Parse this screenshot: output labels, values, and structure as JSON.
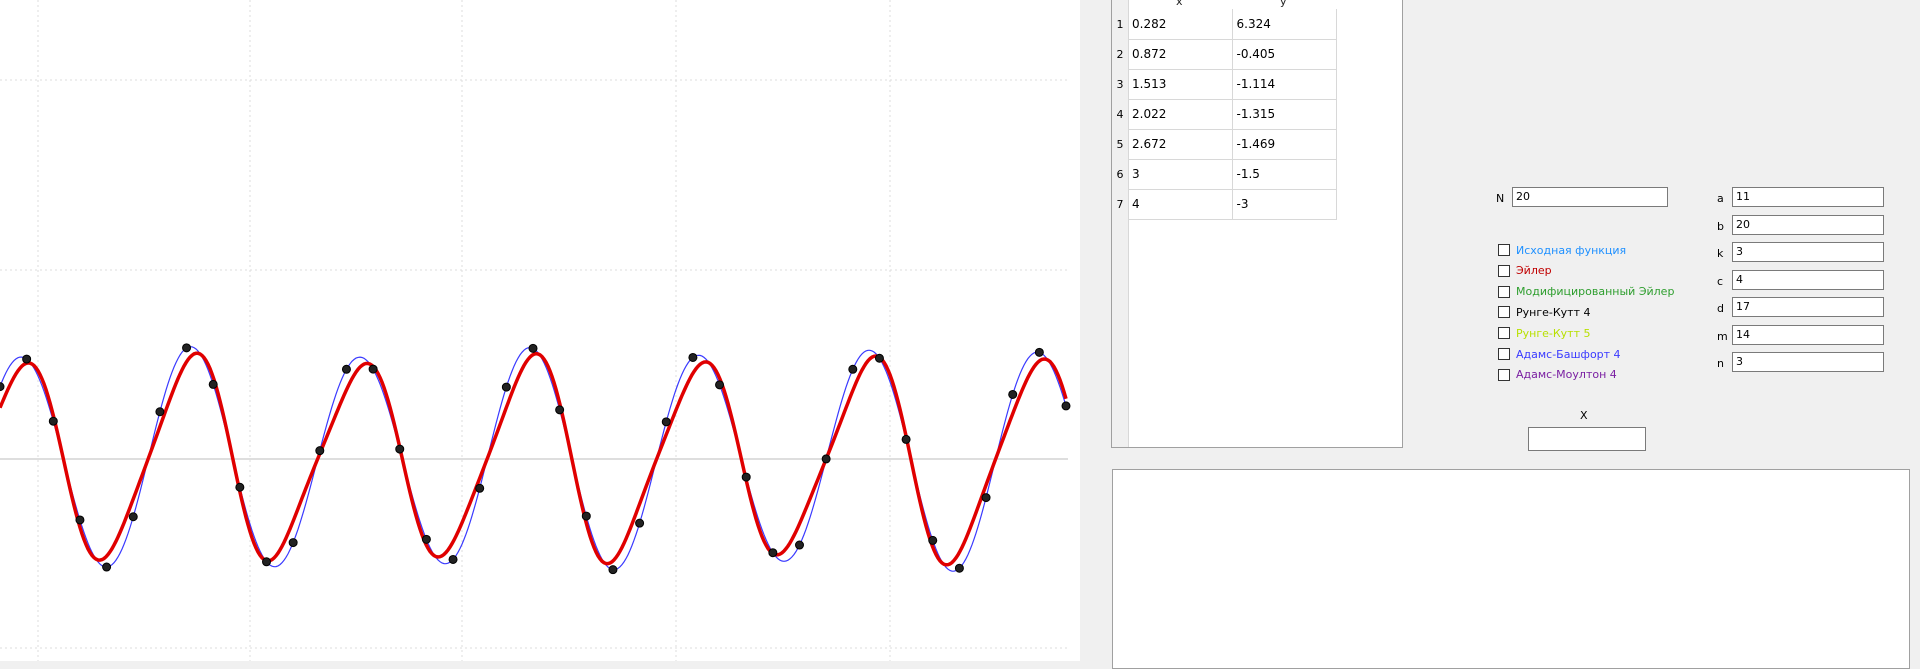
{
  "table": {
    "col_x": "x",
    "col_y": "y",
    "rows": [
      {
        "n": "1",
        "x": "0.282",
        "y": "6.324"
      },
      {
        "n": "2",
        "x": "0.872",
        "y": "-0.405"
      },
      {
        "n": "3",
        "x": "1.513",
        "y": "-1.114"
      },
      {
        "n": "4",
        "x": "2.022",
        "y": "-1.315"
      },
      {
        "n": "5",
        "x": "2.672",
        "y": "-1.469"
      },
      {
        "n": "6",
        "x": "3",
        "y": "-1.5"
      },
      {
        "n": "7",
        "x": "4",
        "y": "-3"
      }
    ]
  },
  "n_field": {
    "label": "N",
    "value": "20"
  },
  "params": [
    {
      "label": "a",
      "value": "11"
    },
    {
      "label": "b",
      "value": "20"
    },
    {
      "label": "k",
      "value": "3"
    },
    {
      "label": "c",
      "value": "4"
    },
    {
      "label": "d",
      "value": "17"
    },
    {
      "label": "m",
      "value": "14"
    },
    {
      "label": "n",
      "value": "3"
    }
  ],
  "methods": [
    {
      "label": "Исходная функция",
      "color": "#1e90ff",
      "checked": false
    },
    {
      "label": "Эйлер",
      "color": "#c00000",
      "checked": false
    },
    {
      "label": "Модифицированный Эйлер",
      "color": "#2e9e2e",
      "checked": false
    },
    {
      "label": "Рунге-Кутт 4",
      "color": "#000000",
      "checked": false
    },
    {
      "label": "Рунге-Кутт 5",
      "color": "#b8e000",
      "checked": false
    },
    {
      "label": "Адамс-Башфорт 4",
      "color": "#3a3aff",
      "checked": false
    },
    {
      "label": "Адамс-Моултон 4",
      "color": "#7a1fa2",
      "checked": false
    }
  ],
  "x_field": {
    "label": "X",
    "value": ""
  }
}
